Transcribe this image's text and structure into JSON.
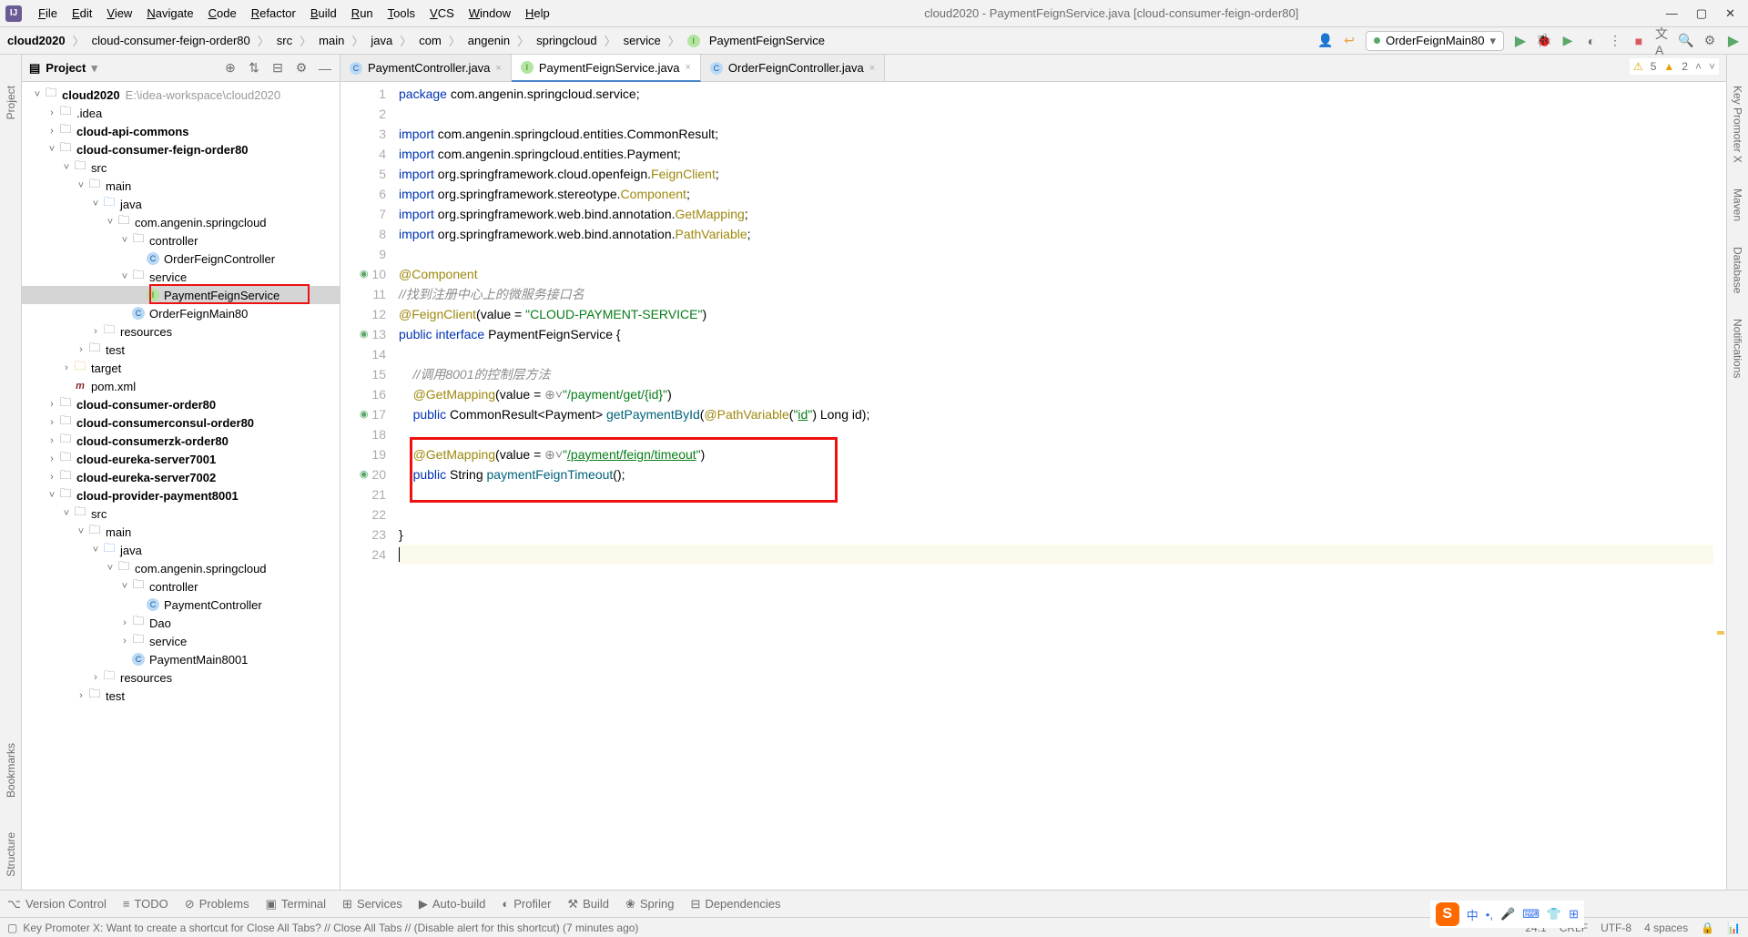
{
  "menu": [
    "File",
    "Edit",
    "View",
    "Navigate",
    "Code",
    "Refactor",
    "Build",
    "Run",
    "Tools",
    "VCS",
    "Window",
    "Help"
  ],
  "window_title": "cloud2020 - PaymentFeignService.java [cloud-consumer-feign-order80]",
  "breadcrumb": [
    "cloud2020",
    "cloud-consumer-feign-order80",
    "src",
    "main",
    "java",
    "com",
    "angenin",
    "springcloud",
    "service",
    "PaymentFeignService"
  ],
  "run_config": "OrderFeignMain80",
  "project_title": "Project",
  "tree": [
    {
      "d": 0,
      "a": "v",
      "i": "folder-i",
      "t": "cloud2020",
      "dim": "E:\\idea-workspace\\cloud2020",
      "bold": true
    },
    {
      "d": 1,
      "a": ">",
      "i": "folder-i",
      "t": ".idea"
    },
    {
      "d": 1,
      "a": ">",
      "i": "folder-i",
      "t": "cloud-api-commons",
      "bold": true
    },
    {
      "d": 1,
      "a": "v",
      "i": "folder-i",
      "t": "cloud-consumer-feign-order80",
      "bold": true
    },
    {
      "d": 2,
      "a": "v",
      "i": "folder-i",
      "t": "src"
    },
    {
      "d": 3,
      "a": "v",
      "i": "folder-i",
      "t": "main"
    },
    {
      "d": 4,
      "a": "v",
      "i": "folder-src",
      "t": "java"
    },
    {
      "d": 5,
      "a": "v",
      "i": "folder-i",
      "t": "com.angenin.springcloud"
    },
    {
      "d": 6,
      "a": "v",
      "i": "folder-i",
      "t": "controller"
    },
    {
      "d": 7,
      "a": "",
      "i": "class-i",
      "t": "OrderFeignController"
    },
    {
      "d": 6,
      "a": "v",
      "i": "folder-i",
      "t": "service"
    },
    {
      "d": 7,
      "a": "",
      "i": "interface-i",
      "t": "PaymentFeignService",
      "sel": true,
      "box": true
    },
    {
      "d": 6,
      "a": "",
      "i": "class-i",
      "t": "OrderFeignMain80"
    },
    {
      "d": 4,
      "a": ">",
      "i": "folder-res",
      "t": "resources"
    },
    {
      "d": 3,
      "a": ">",
      "i": "folder-i",
      "t": "test"
    },
    {
      "d": 2,
      "a": ">",
      "i": "folder-target",
      "t": "target"
    },
    {
      "d": 2,
      "a": "",
      "i": "pom-i",
      "t": "pom.xml"
    },
    {
      "d": 1,
      "a": ">",
      "i": "folder-i",
      "t": "cloud-consumer-order80",
      "bold": true
    },
    {
      "d": 1,
      "a": ">",
      "i": "folder-i",
      "t": "cloud-consumerconsul-order80",
      "bold": true
    },
    {
      "d": 1,
      "a": ">",
      "i": "folder-i",
      "t": "cloud-consumerzk-order80",
      "bold": true
    },
    {
      "d": 1,
      "a": ">",
      "i": "folder-i",
      "t": "cloud-eureka-server7001",
      "bold": true
    },
    {
      "d": 1,
      "a": ">",
      "i": "folder-i",
      "t": "cloud-eureka-server7002",
      "bold": true
    },
    {
      "d": 1,
      "a": "v",
      "i": "folder-i",
      "t": "cloud-provider-payment8001",
      "bold": true
    },
    {
      "d": 2,
      "a": "v",
      "i": "folder-i",
      "t": "src"
    },
    {
      "d": 3,
      "a": "v",
      "i": "folder-i",
      "t": "main"
    },
    {
      "d": 4,
      "a": "v",
      "i": "folder-src",
      "t": "java"
    },
    {
      "d": 5,
      "a": "v",
      "i": "folder-i",
      "t": "com.angenin.springcloud"
    },
    {
      "d": 6,
      "a": "v",
      "i": "folder-i",
      "t": "controller"
    },
    {
      "d": 7,
      "a": "",
      "i": "class-i",
      "t": "PaymentController"
    },
    {
      "d": 6,
      "a": ">",
      "i": "folder-i",
      "t": "Dao"
    },
    {
      "d": 6,
      "a": ">",
      "i": "folder-i",
      "t": "service"
    },
    {
      "d": 6,
      "a": "",
      "i": "class-i",
      "t": "PaymentMain8001"
    },
    {
      "d": 4,
      "a": ">",
      "i": "folder-res",
      "t": "resources"
    },
    {
      "d": 3,
      "a": ">",
      "i": "folder-i",
      "t": "test"
    }
  ],
  "tabs": [
    {
      "label": "PaymentController.java",
      "icon": "class-i"
    },
    {
      "label": "PaymentFeignService.java",
      "icon": "interface-i",
      "active": true
    },
    {
      "label": "OrderFeignController.java",
      "icon": "class-i"
    }
  ],
  "warnings": {
    "a": "5",
    "b": "2"
  },
  "code": {
    "lines": [
      {
        "n": 1,
        "html": "<span class='k'>package</span> com.angenin.springcloud.service;"
      },
      {
        "n": 2,
        "html": ""
      },
      {
        "n": 3,
        "html": "<span class='k'>import</span> com.angenin.springcloud.entities.CommonResult;"
      },
      {
        "n": 4,
        "html": "<span class='k'>import</span> com.angenin.springcloud.entities.Payment;"
      },
      {
        "n": 5,
        "html": "<span class='k'>import</span> org.springframework.cloud.openfeign.<span class='anncls'>FeignClient</span>;"
      },
      {
        "n": 6,
        "html": "<span class='k'>import</span> org.springframework.stereotype.<span class='anncls'>Component</span>;"
      },
      {
        "n": 7,
        "html": "<span class='k'>import</span> org.springframework.web.bind.annotation.<span class='anncls'>GetMapping</span>;"
      },
      {
        "n": 8,
        "html": "<span class='k'>import</span> org.springframework.web.bind.annotation.<span class='anncls'>PathVariable</span>;"
      },
      {
        "n": 9,
        "html": ""
      },
      {
        "n": 10,
        "g": "●",
        "html": "<span class='ann'>@Component</span>"
      },
      {
        "n": 11,
        "html": "<span class='com'>//找到注册中心上的微服务接口名</span>"
      },
      {
        "n": 12,
        "html": "<span class='ann'>@FeignClient</span>(value = <span class='str'>\"CLOUD-PAYMENT-SERVICE\"</span>)"
      },
      {
        "n": 13,
        "g": "●",
        "html": "<span class='k'>public</span> <span class='k'>interface</span> <span class='cls'>PaymentFeignService</span> {"
      },
      {
        "n": 14,
        "html": ""
      },
      {
        "n": 15,
        "html": "    <span class='com'>//调用8001的控制层方法</span>"
      },
      {
        "n": 16,
        "html": "    <span class='ann'>@GetMapping</span>(value = <span style='color:#888'>⊕˅</span><span class='str'>\"/payment/get/{id}\"</span>)"
      },
      {
        "n": 17,
        "g": "●",
        "html": "    <span class='k'>public</span> CommonResult&lt;Payment&gt; <span class='fn'>getPaymentById</span>(<span class='ann'>@PathVariable</span>(<span class='str'>\"<u>id</u>\"</span>) Long id);"
      },
      {
        "n": 18,
        "html": ""
      },
      {
        "n": 19,
        "html": "    <span class='ann'>@GetMapping</span>(value = <span style='color:#888'>⊕˅</span><span class='str'>\"</span><span class='pth'>/payment/feign/timeout</span><span class='str'>\"</span>)"
      },
      {
        "n": 20,
        "g": "●",
        "html": "    <span class='k'>public</span> String <span class='fn'>paymentFeignTimeout</span>();"
      },
      {
        "n": 21,
        "html": ""
      },
      {
        "n": 22,
        "html": ""
      },
      {
        "n": 23,
        "html": "}"
      },
      {
        "n": 24,
        "cur": true,
        "html": "<span style='border-left:1px solid #000;'>&nbsp;</span>"
      }
    ]
  },
  "left_tabs": [
    "Project",
    "Bookmarks",
    "Structure"
  ],
  "right_tabs": [
    "Key Promoter X",
    "Maven",
    "Database",
    "Notifications"
  ],
  "bottom_items": [
    "Version Control",
    "TODO",
    "Problems",
    "Terminal",
    "Services",
    "Auto-build",
    "Profiler",
    "Build",
    "Spring",
    "Dependencies"
  ],
  "status_msg": "Key Promoter X: Want to create a shortcut for Close All Tabs? // Close All Tabs // (Disable alert for this shortcut) (7 minutes ago)",
  "status_right": {
    "pos": "24:1",
    "eol": "CRLF",
    "enc": "UTF-8",
    "indent": "4 spaces"
  }
}
